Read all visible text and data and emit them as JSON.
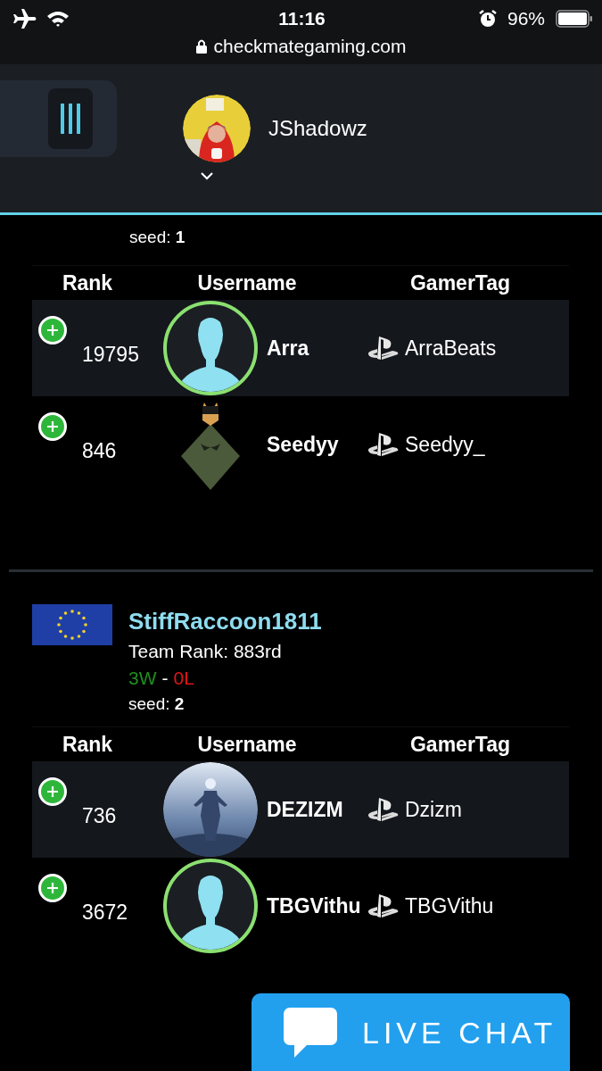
{
  "status_bar": {
    "time": "11:16",
    "battery": "96%"
  },
  "address_bar": {
    "url": "checkmategaming.com"
  },
  "header": {
    "username": "JShadowz"
  },
  "teams": [
    {
      "seed": "seed: **1**",
      "columns": [
        "Rank",
        "Username",
        "GamerTag"
      ],
      "players": [
        {
          "rank": "19795",
          "kind": "silhouette",
          "username": "Arra",
          "gamertag": "ArraBeats"
        },
        {
          "rank": "846",
          "kind": "picture",
          "username": "Seedyy",
          "gamertag": "Seedyy_"
        }
      ]
    },
    {
      "name": "StiffRaccoon1811",
      "team_rank": "Team Rank: 883rd",
      "wins": "3W",
      "separator": "-",
      "losses": "0L",
      "seed": "seed: **2**",
      "columns": [
        "Rank",
        "Username",
        "GamerTag"
      ],
      "players": [
        {
          "rank": "736",
          "kind": "picture",
          "username": "DEZIZM",
          "gamertag": "Dzizm"
        },
        {
          "rank": "3672",
          "kind": "silhouette",
          "username": "TBGVithu",
          "gamertag": "TBGVithu"
        }
      ]
    }
  ],
  "live_chat": {
    "label": "LIVE CHAT"
  }
}
